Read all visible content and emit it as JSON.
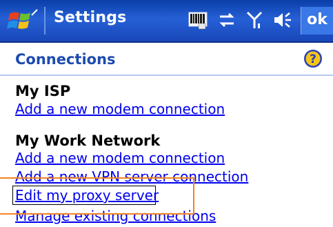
{
  "titlebar": {
    "title": "Settings",
    "ok_label": "ok",
    "icons": [
      "windows-logo",
      "keyboard-icon",
      "connectivity-icon",
      "signal-icon",
      "volume-icon"
    ]
  },
  "section": {
    "title": "Connections",
    "help_icon": "help-icon"
  },
  "groups": [
    {
      "title": "My ISP",
      "links": [
        "Add a new modem connection"
      ]
    },
    {
      "title": "My Work Network",
      "links": [
        "Add a new modem connection",
        "Add a new VPN server connection",
        "Edit my proxy server",
        "Manage existing connections"
      ]
    }
  ],
  "colors": {
    "titlebar": "#1847b8",
    "section_title": "#1d4ab0",
    "link": "#0000ee",
    "callout": "#f28322"
  }
}
